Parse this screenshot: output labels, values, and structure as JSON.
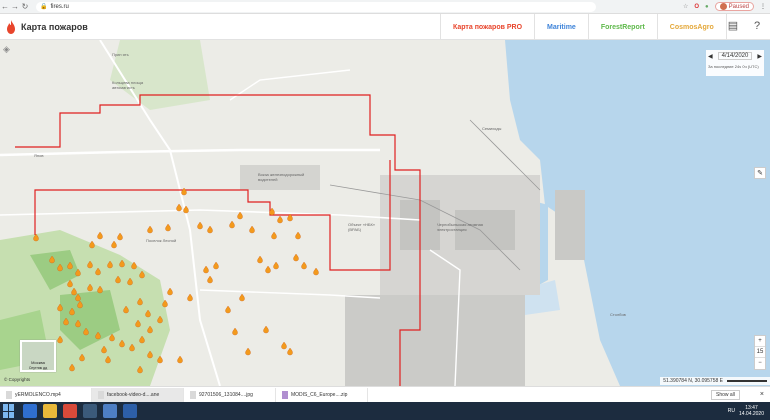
{
  "browser": {
    "url": "fires.ru",
    "paused_label": "Paused",
    "back_icon": "back-arrow-icon",
    "forward_icon": "forward-arrow-icon",
    "reload_icon": "reload-icon"
  },
  "header": {
    "site_title": "Карта пожаров",
    "nav": [
      {
        "label": "Карта пожаров PRO",
        "color": "#e8452c"
      },
      {
        "label": "Maritime",
        "color": "#3f84d9"
      },
      {
        "label": "ForestReport",
        "color": "#5fb94b"
      },
      {
        "label": "CosmosAgro",
        "color": "#e4a83a"
      }
    ],
    "icons": [
      "book-icon",
      "help-icon"
    ]
  },
  "map": {
    "date_value": "4/14/2020",
    "date_caption": "За последние 24ч 0ч (UTC)",
    "zoom_level": "15",
    "zoom_in": "+",
    "zoom_out": "−",
    "minimap_label": "Москва",
    "minimap_sub": "Спутник дд",
    "copyright": "© Copyrights",
    "coordinates": "51.390784 N, 30.095758 E",
    "labels": {
      "l1": "Прип ять",
      "l2": "Кольцева площа автомагисть",
      "l3": "Вокза железнодорожный водителей",
      "l4": "Семиходы",
      "l5": "Поселок Лесной",
      "l6": "Объект «НБК» (ВРАБ)",
      "l7": "Чернобыльская атомная электростанция",
      "l8": "Столбов",
      "l9": "Янов"
    },
    "colors": {
      "water": "#b7d6ec",
      "forest": "#c6dfb0",
      "border": "#e02020",
      "fire": "#f39a1c"
    }
  },
  "downloads": {
    "items": [
      "yERMOLENCO.mp4",
      "facebook-video-d....ane",
      "92701506_131084....jpg",
      "MODIS_C6_Europe....zip"
    ],
    "show_all": "Show all",
    "close": "×"
  },
  "taskbar": {
    "tray_lang": "RU",
    "time": "13:47",
    "date": "14.04.2020"
  }
}
